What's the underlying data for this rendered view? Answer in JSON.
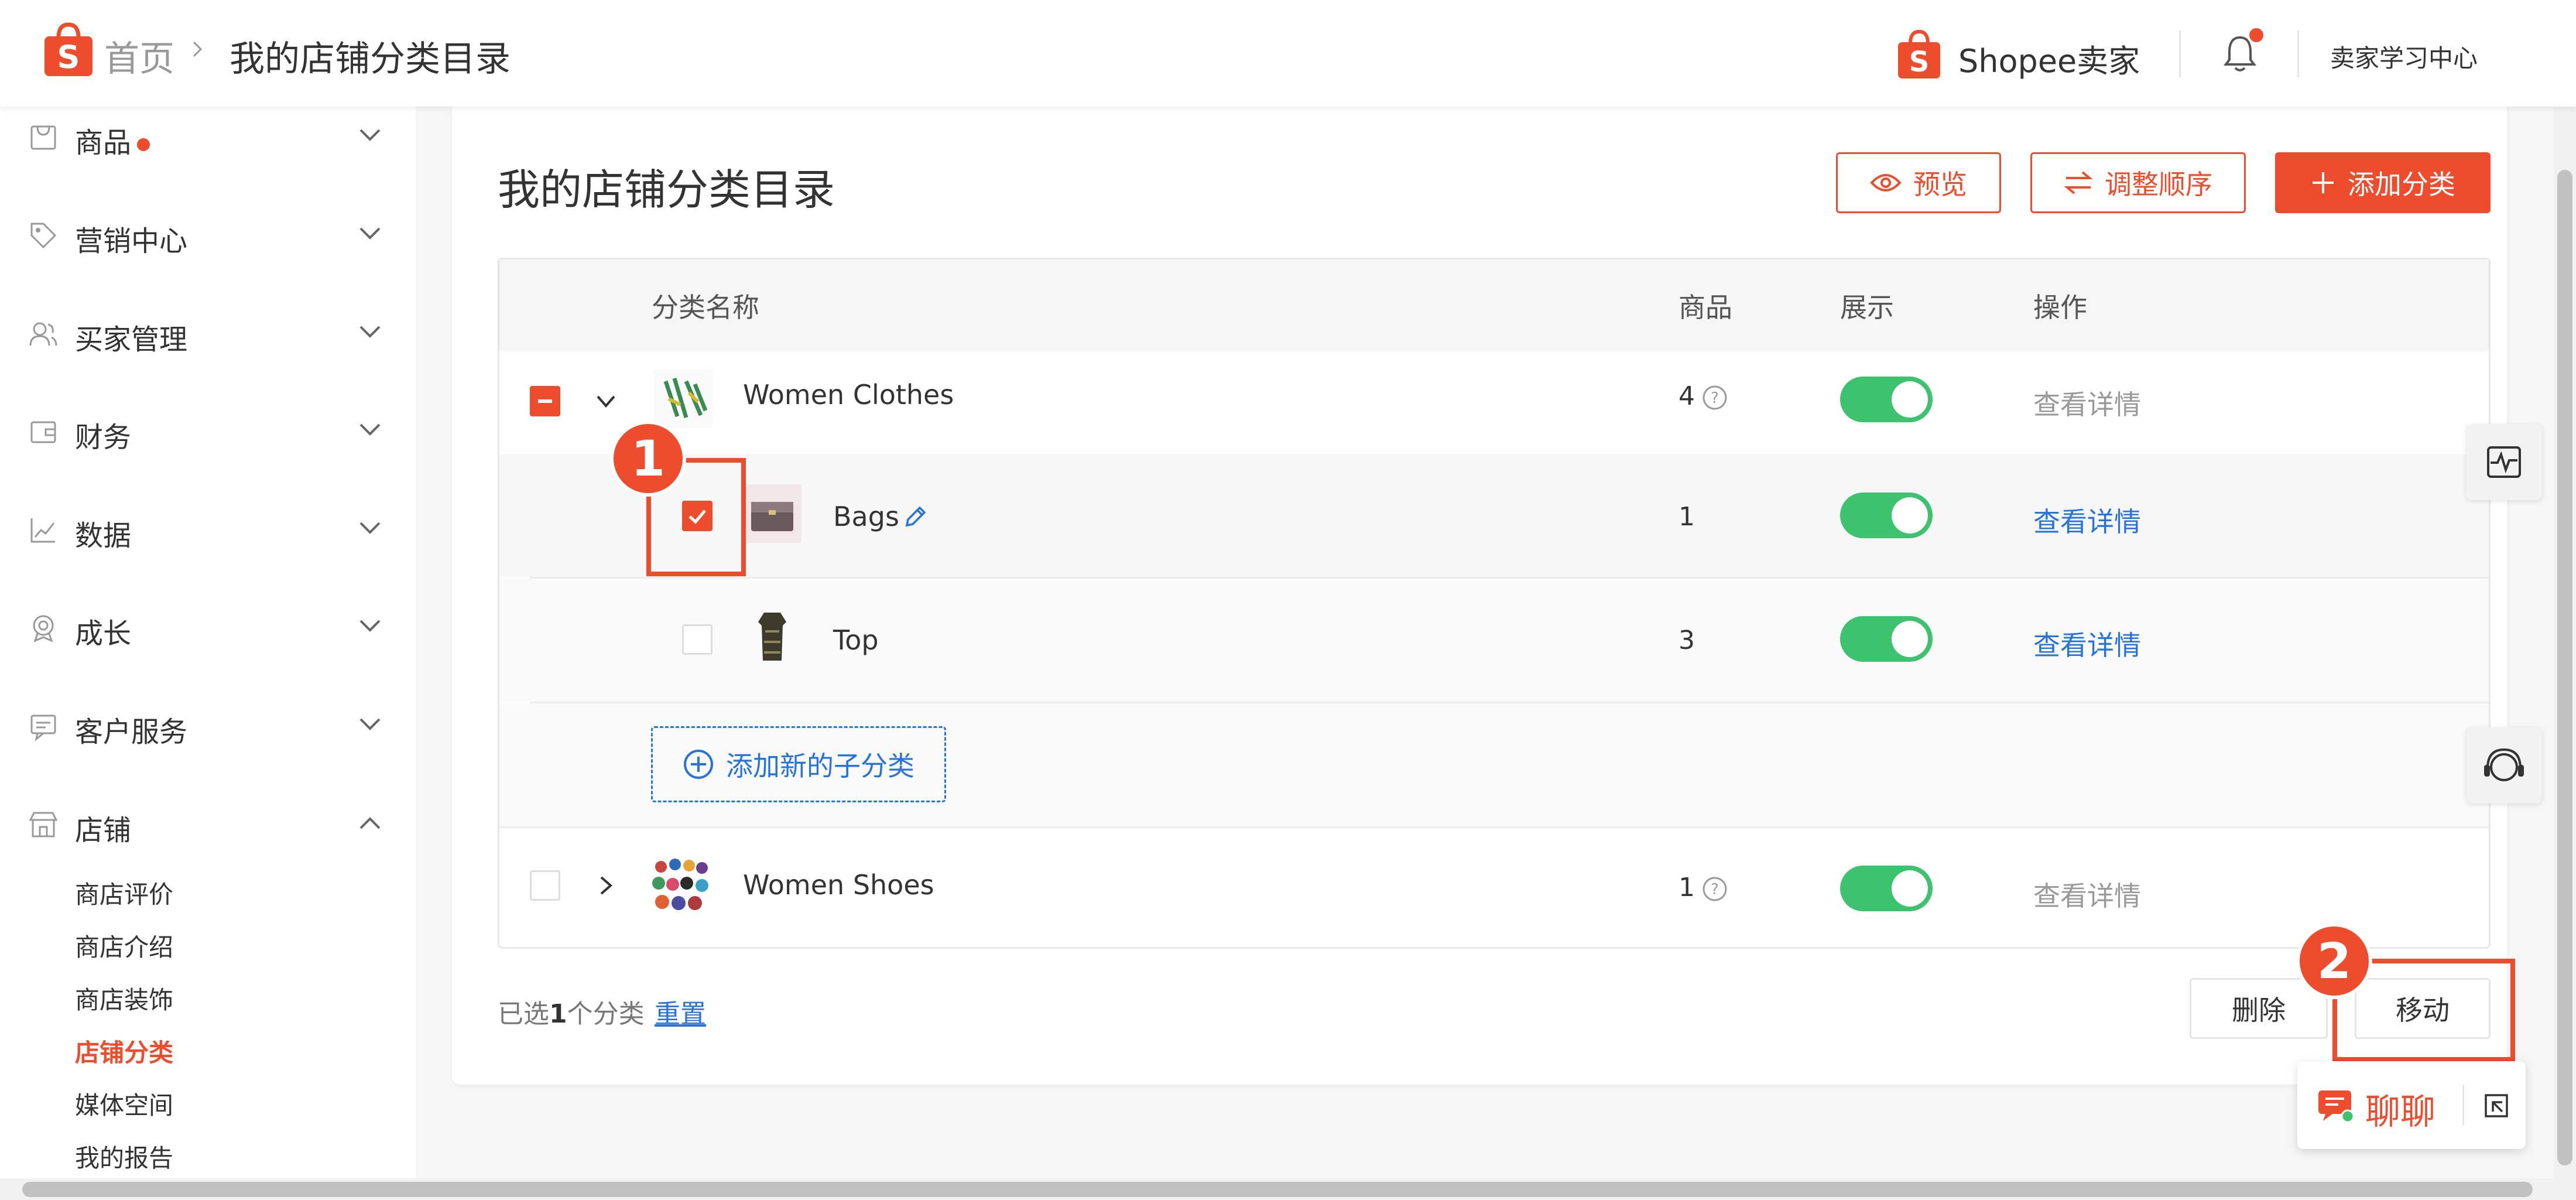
{
  "header": {
    "home": "首页",
    "breadcrumb_title": "我的店铺分类目录",
    "seller_brand": "Shopee卖家",
    "learning_center": "卖家学习中心"
  },
  "sidebar": {
    "items": [
      {
        "label": "商品",
        "icon": "product-icon"
      },
      {
        "label": "营销中心",
        "icon": "tag-icon"
      },
      {
        "label": "买家管理",
        "icon": "users-icon"
      },
      {
        "label": "财务",
        "icon": "wallet-icon"
      },
      {
        "label": "数据",
        "icon": "chart-icon"
      },
      {
        "label": "成长",
        "icon": "badge-icon"
      },
      {
        "label": "客户服务",
        "icon": "message-icon"
      },
      {
        "label": "店铺",
        "icon": "shop-icon"
      }
    ],
    "shop_sub_items": [
      "商店评价",
      "商店介绍",
      "商店装饰",
      "店铺分类",
      "媒体空间",
      "我的报告"
    ],
    "active_sub_item": "店铺分类"
  },
  "main": {
    "title": "我的店铺分类目录",
    "buttons": {
      "preview": "预览",
      "reorder": "调整顺序",
      "add_category": "添加分类"
    },
    "table": {
      "columns": [
        "分类名称",
        "商品",
        "展示",
        "操作"
      ],
      "rows": [
        {
          "name": "Women Clothes",
          "count": "4",
          "action": "查看详情"
        },
        {
          "name": "Bags",
          "count": "1",
          "action": "查看详情"
        },
        {
          "name": "Top",
          "count": "3",
          "action": "查看详情"
        },
        {
          "name": "Women Shoes",
          "count": "1",
          "action": "查看详情"
        }
      ],
      "add_subcategory": "添加新的子分类"
    },
    "footer": {
      "selected_prefix": "已选",
      "selected_count": "1",
      "selected_suffix": "个分类",
      "reset": "重置",
      "delete": "删除",
      "move": "移动"
    }
  },
  "annotations": {
    "step1": "1",
    "step2": "2"
  },
  "chat": {
    "label": "聊聊"
  },
  "colors": {
    "brand": "#ee4d2d",
    "link": "#2673dd",
    "toggle_on": "#3dc26e"
  }
}
